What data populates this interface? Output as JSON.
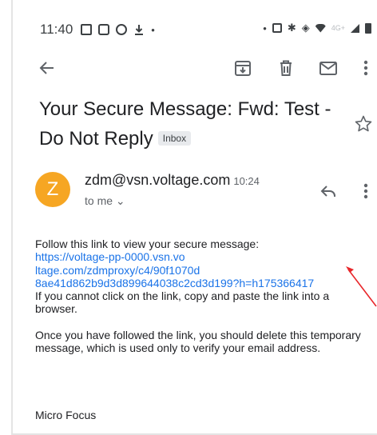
{
  "status_bar": {
    "time": "11:40",
    "dot_left": "•",
    "dot_right": "•",
    "network_label": "4G+"
  },
  "toolbar": {
    "icons": [
      "back-arrow-icon",
      "archive-icon",
      "trash-icon",
      "mail-icon",
      "more-vert-icon"
    ]
  },
  "email": {
    "subject": "Your Secure Message: Fwd: Test - Do Not Reply",
    "label": "Inbox",
    "sender": "zdm@vsn.voltage.com",
    "time": "10:24",
    "avatar_letter": "Z",
    "recipient": "to me ⌄",
    "body": {
      "intro": "Follow this link to view your secure message:",
      "link_lines": [
        "https://voltage-pp-0000.vsn.vo",
        "ltage.com/zdmproxy/c4/90f1070d",
        "8ae41d862b9d3d899644038c2cd3d199?h=h175366417"
      ],
      "instruction": "If you cannot click on the link, copy and paste the link into a browser.",
      "notice": "Once you have followed the link, you should delete this temporary message, which is used only to verify your email address.",
      "signature": "Micro Focus"
    }
  },
  "colors": {
    "avatar": "#f6a623",
    "link": "#1a73e8",
    "annotation_arrow": "#e8262a"
  }
}
